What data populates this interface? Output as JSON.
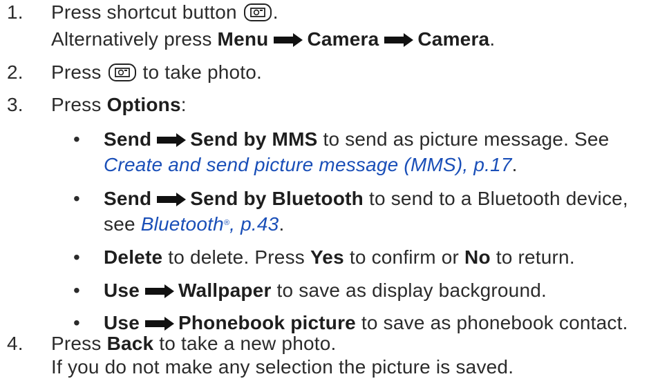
{
  "steps": [
    {
      "num": "1.",
      "line1": {
        "pre": "Press shortcut button ",
        "post": "."
      },
      "line2": {
        "pre": "Alternatively press ",
        "b1": "Menu",
        "b2": "Camera",
        "b3": "Camera",
        "post": "."
      }
    },
    {
      "num": "2.",
      "line1": {
        "pre": "Press ",
        "post": " to take photo."
      }
    },
    {
      "num": "3.",
      "line1": {
        "pre": "Press ",
        "b1": "Options",
        "post": ":"
      }
    },
    {
      "num": "4.",
      "line1": {
        "pre": "Press ",
        "b1": "Back",
        "post": " to take a new photo."
      },
      "line2": {
        "text": "If you do not make any selection the picture is saved."
      }
    }
  ],
  "options": {
    "bullet": "•",
    "send_mms": {
      "b1": "Send",
      "b2": "Send by MMS",
      "post": " to send as picture message. See",
      "link": "Create and send picture message (MMS), p.17",
      "link_post": "."
    },
    "send_bt": {
      "b1": "Send",
      "b2": "Send by Bluetooth",
      "post": " to send to a Bluetooth device,",
      "pre2": "see ",
      "link": "Bluetooth",
      "reg": "®",
      "link2": ", p.43",
      "link_post": "."
    },
    "delete": {
      "b1": "Delete",
      "mid1": " to delete. Press ",
      "b2": "Yes",
      "mid2": " to confirm or ",
      "b3": "No",
      "post": " to return."
    },
    "wallpaper": {
      "b1": "Use",
      "b2": "Wallpaper",
      "post": " to save as display background."
    },
    "phonebook": {
      "b1": "Use",
      "b2": "Phonebook picture",
      "post": " to save as phonebook contact."
    }
  },
  "icons": {
    "arrow": "right-arrow-icon",
    "camera_key": "camera-key-icon"
  },
  "colors": {
    "text": "#2b2b2b",
    "link": "#1a4fb8",
    "arrow": "#111111"
  }
}
